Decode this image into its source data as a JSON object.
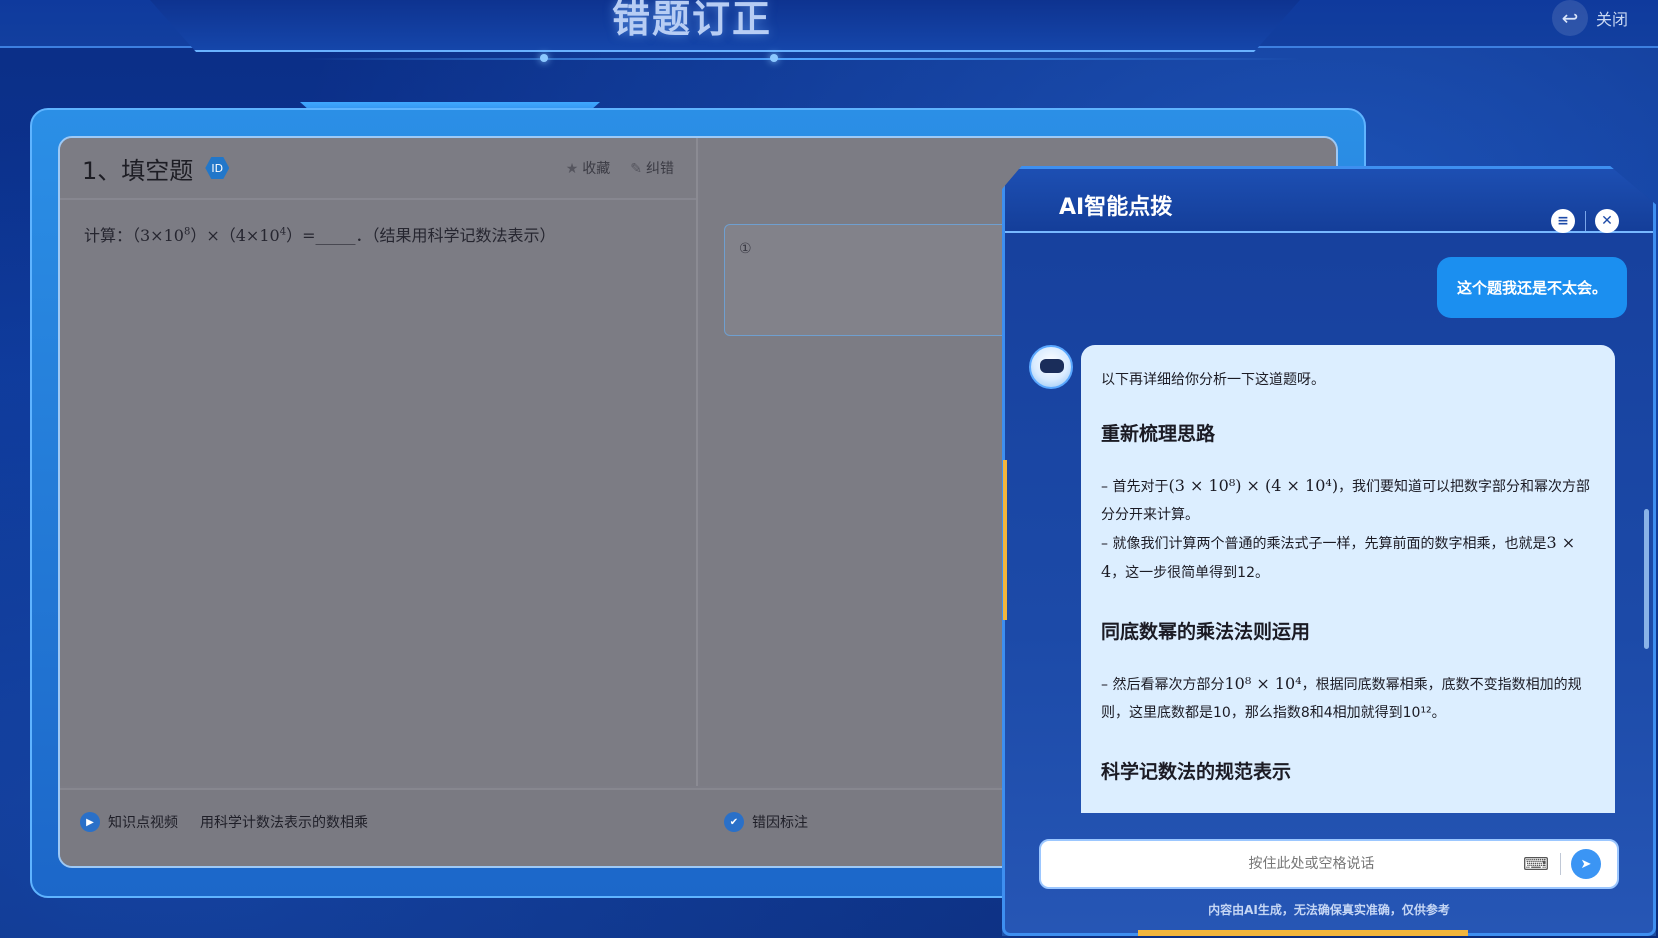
{
  "header": {
    "title": "错题订正",
    "close_label": "关闭"
  },
  "question": {
    "title": "1、填空题",
    "id_badge": "ID",
    "favorite_label": "收藏",
    "report_label": "纠错",
    "prefix": "计算：（3×10",
    "exp1": "8",
    "mid": "）×（4×10",
    "exp2": "4",
    "suffix": "）=_____．（结果用科学记数法表示）"
  },
  "answer": {
    "number": "①"
  },
  "footer": {
    "video_label": "知识点视频",
    "video_topic": "用科学计数法表示的数相乘",
    "error_label": "错因标注"
  },
  "ai_panel": {
    "title": "AI智能点拨",
    "user_message": "这个题我还是不太会。",
    "intro": "以下再详细给你分析一下这道题呀。",
    "h1": "重新梳理思路",
    "p1a": "– 首先对于",
    "p1m": "(3 × 10⁸) × (4 × 10⁴)",
    "p1b": "，我们要知道可以把数字部分和幂次方部分分开来计算。",
    "p2a": "– 就像我们计算两个普通的乘法式子一样，先算前面的数字相乘，也就是",
    "p2m": "3 × 4",
    "p2b": "，这一步很简单得到12。",
    "h2": "同底数幂的乘法法则运用",
    "p3a": "– 然后看幂次方部分",
    "p3m": "10⁸ × 10⁴",
    "p3b": "，根据同底数幂相乘，底数不变指数相加的规则，这里底数都是10，那么指数8和4相加就得到10¹²。",
    "h3": "科学记数法的规范表示",
    "input_placeholder": "按住此处或空格说话",
    "disclaimer": "内容由AI生成，无法确保真实准确，仅供参考"
  }
}
